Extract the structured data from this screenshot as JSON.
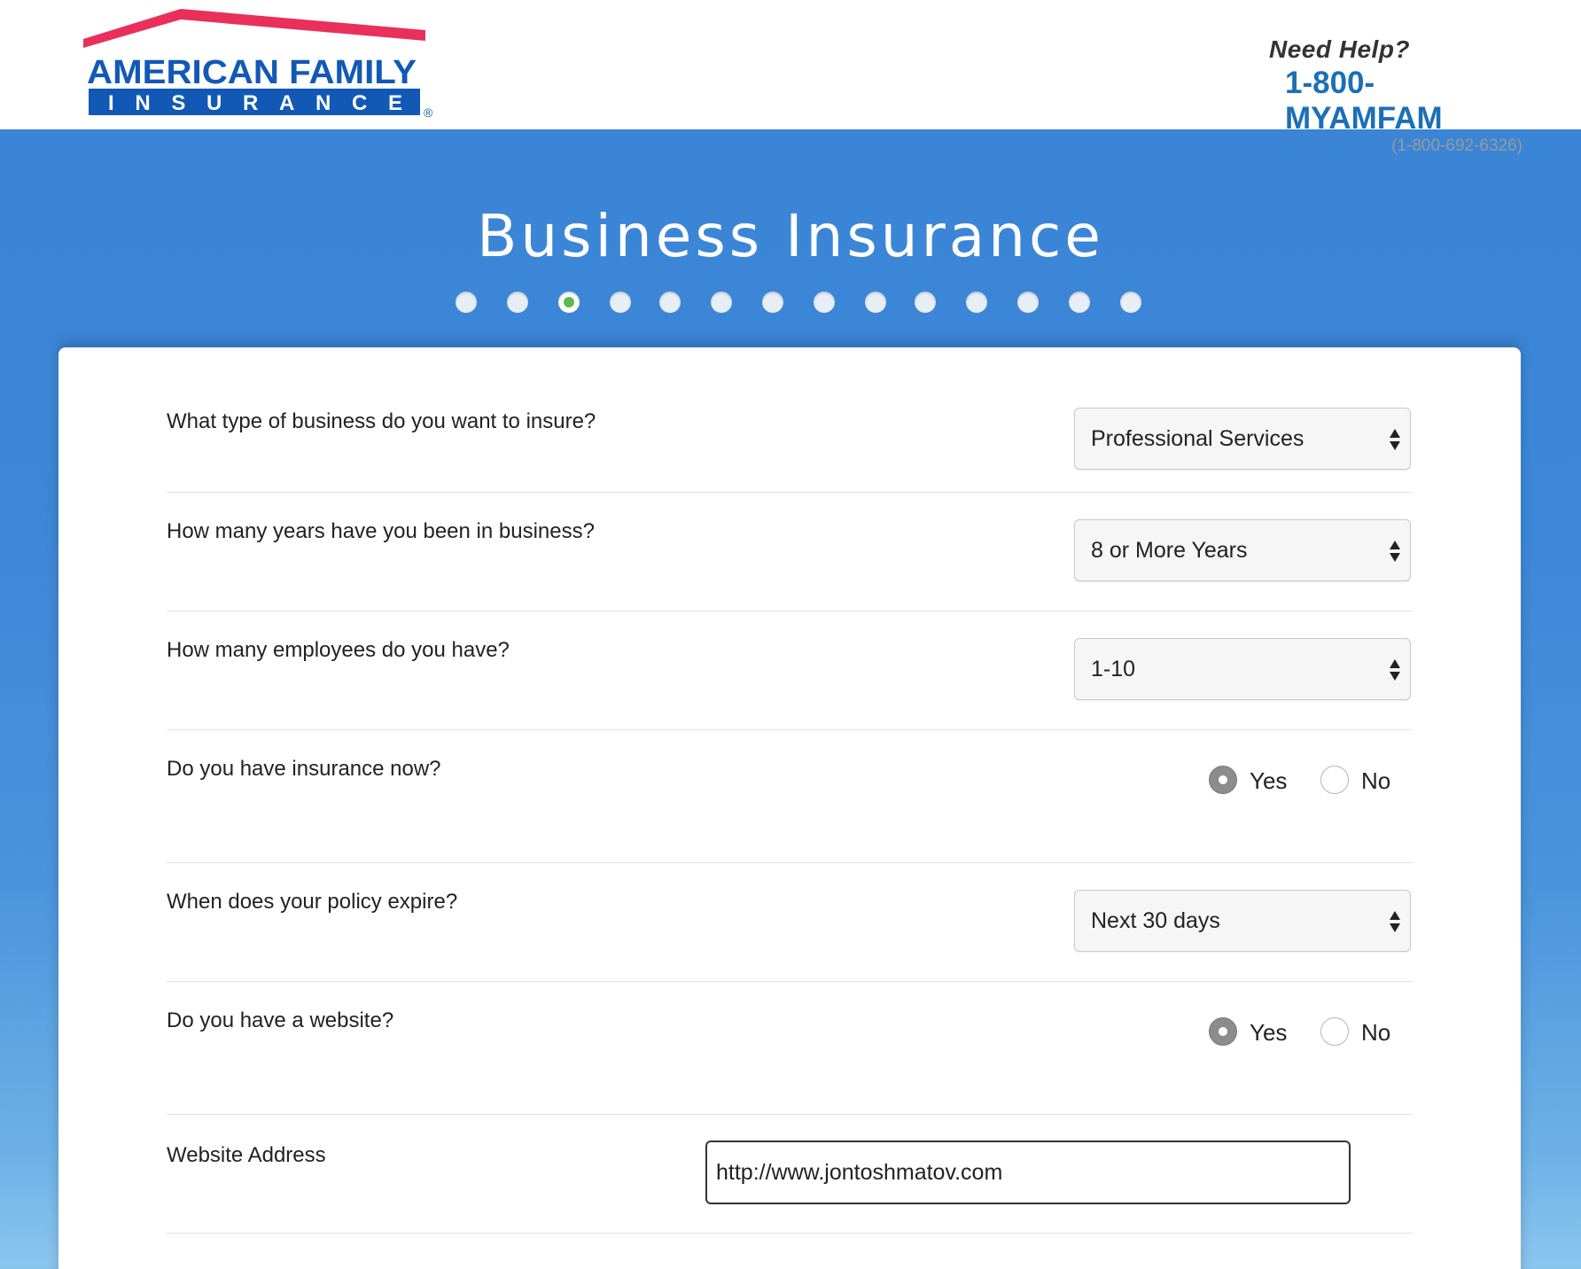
{
  "brand": {
    "logo_top": "AMERICAN FAMILY",
    "logo_bottom": "INSURANCE",
    "logo_mark": "®",
    "colors": {
      "roof": "#e8305a",
      "blue": "#1259b5",
      "accent": "#3a84d6"
    }
  },
  "help": {
    "title": "Need Help?",
    "phone": "1-800-MYAMFAM",
    "number": "(1-800-692-6326)"
  },
  "page": {
    "title": "Business Insurance",
    "steps_total": 14,
    "current_step": 3
  },
  "form": {
    "business_type": {
      "question": "What type of business do you want to insure?",
      "value": "Professional Services"
    },
    "years": {
      "question": "How many years have you been in business?",
      "value": "8 or More Years"
    },
    "employees": {
      "question": "How many employees do you have?",
      "value": "1-10"
    },
    "has_insurance": {
      "question": "Do you have insurance now?",
      "yes": "Yes",
      "no": "No",
      "selected": "Yes"
    },
    "policy_expire": {
      "question": "When does your policy expire?",
      "value": "Next 30 days"
    },
    "has_website": {
      "question": "Do you have a website?",
      "yes": "Yes",
      "no": "No",
      "selected": "Yes"
    },
    "website": {
      "label": "Website Address",
      "value": "http://www.jontoshmatov.com"
    }
  }
}
